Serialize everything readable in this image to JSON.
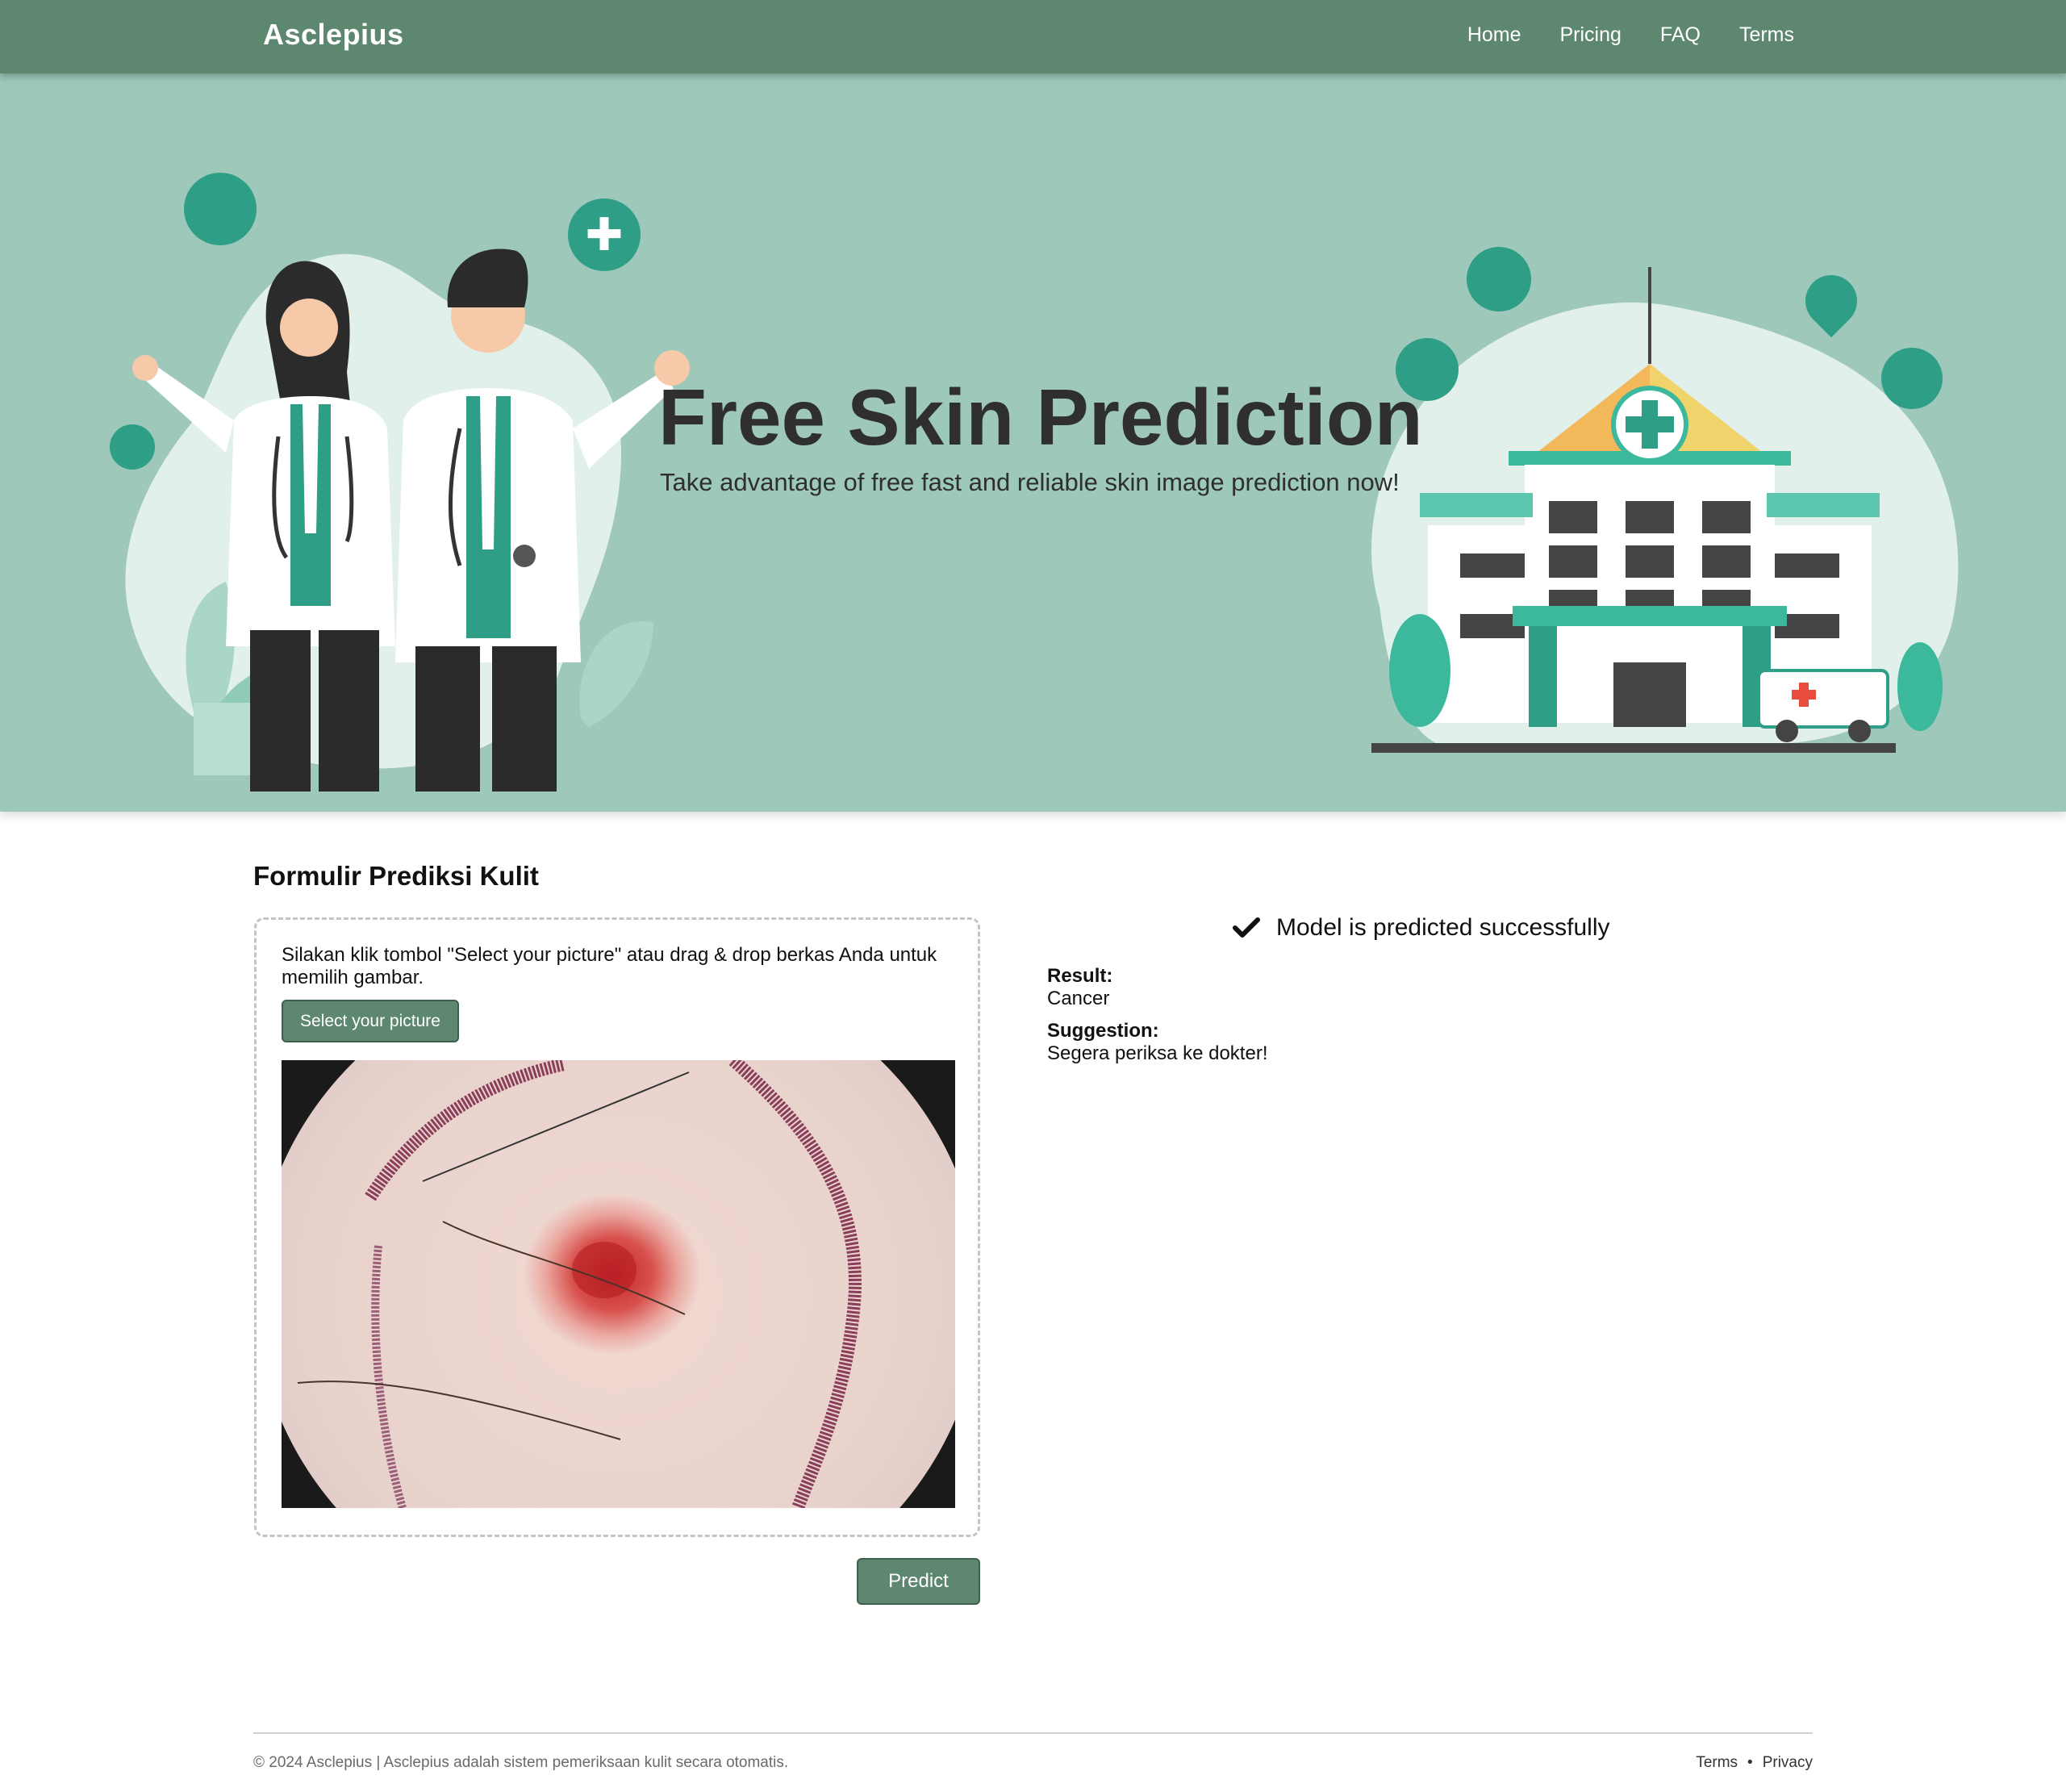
{
  "navbar": {
    "brand": "Asclepius",
    "links": [
      "Home",
      "Pricing",
      "FAQ",
      "Terms"
    ]
  },
  "hero": {
    "title": "Free Skin Prediction",
    "subtitle": "Take advantage of free fast and reliable skin image prediction now!"
  },
  "form": {
    "title": "Formulir Prediksi Kulit",
    "help_text": "Silakan klik tombol \"Select your picture\" atau drag & drop berkas Anda untuk memilih gambar.",
    "select_label": "Select your picture",
    "predict_label": "Predict"
  },
  "result": {
    "status": "Model is predicted successfully",
    "result_label": "Result:",
    "result_value": "Cancer",
    "suggestion_label": "Suggestion:",
    "suggestion_value": "Segera periksa ke dokter!"
  },
  "footer": {
    "copyright": "© 2024 Asclepius | Asclepius adalah sistem pemeriksaan kulit secara otomatis.",
    "terms": "Terms",
    "separator": "•",
    "privacy": "Privacy"
  },
  "colors": {
    "navbar": "#5e8770",
    "hero": "#9ec8b9",
    "button": "#5e8770",
    "teal_accent": "#2e9e86"
  }
}
